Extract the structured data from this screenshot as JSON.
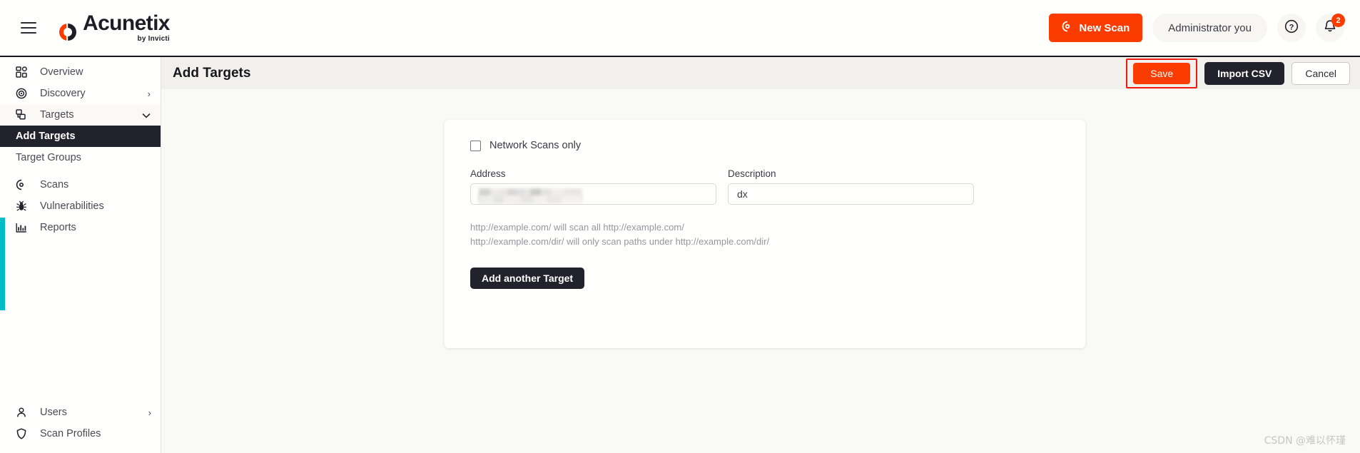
{
  "brand": {
    "name": "Acunetix",
    "sub": "by Invicti",
    "logo_icon": "acunetix-logo-icon",
    "menu_icon": "hamburger-menu-icon"
  },
  "topbar": {
    "new_scan_label": "New Scan",
    "new_scan_icon": "scan-icon",
    "new_scan_color": "#fa3c00",
    "admin_label": "Administrator you",
    "help_icon": "question-mark-icon",
    "notifications_icon": "bell-icon",
    "notifications_count": "2",
    "badge_color": "#fa3c00"
  },
  "sidebar": {
    "accent_color": "#00bcc9",
    "items": [
      {
        "label": "Overview",
        "icon": "grid-icon",
        "chevron": ""
      },
      {
        "label": "Discovery",
        "icon": "target-rings-icon",
        "chevron": "›"
      },
      {
        "label": "Targets",
        "icon": "targets-stack-icon",
        "chevron": "⌄"
      }
    ],
    "sub_items": [
      {
        "label": "Add Targets",
        "active": true
      },
      {
        "label": "Target Groups",
        "active": false
      }
    ],
    "items_after": [
      {
        "label": "Scans",
        "icon": "scan-icon",
        "chevron": ""
      },
      {
        "label": "Vulnerabilities",
        "icon": "bug-icon",
        "chevron": ""
      },
      {
        "label": "Reports",
        "icon": "bar-chart-icon",
        "chevron": ""
      }
    ],
    "bottom_items": [
      {
        "label": "Users",
        "icon": "user-icon",
        "chevron": "›"
      },
      {
        "label": "Scan Profiles",
        "icon": "shield-icon",
        "chevron": ""
      }
    ]
  },
  "page": {
    "title": "Add Targets",
    "save_label": "Save",
    "import_label": "Import CSV",
    "cancel_label": "Cancel",
    "save_highlight_color": "#ee1b0f"
  },
  "form": {
    "network_scans_label": "Network Scans only",
    "network_scans_checked": false,
    "address_label": "Address",
    "address_value": "",
    "address_placeholder": "",
    "address_redacted": true,
    "description_label": "Description",
    "description_value": "dx",
    "description_placeholder": "",
    "help_line_1": "http://example.com/ will scan all http://example.com/",
    "help_line_2": "http://example.com/dir/ will only scan paths under http://example.com/dir/",
    "add_another_label": "Add another Target"
  },
  "watermark": {
    "text": "CSDN @难以怀瑾"
  }
}
